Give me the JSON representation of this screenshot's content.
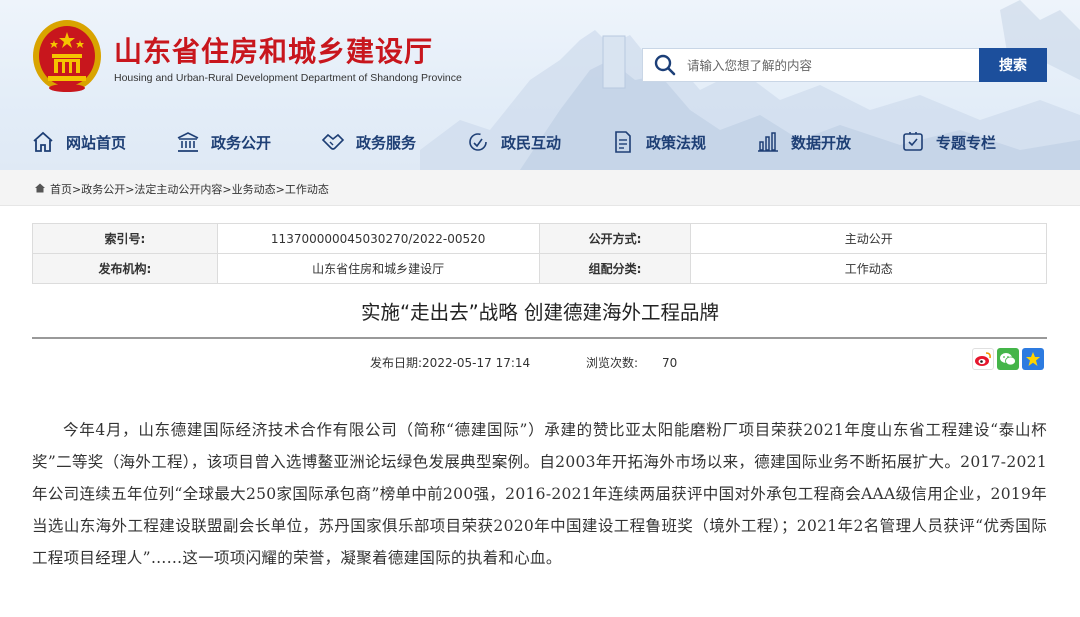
{
  "header": {
    "title": "山东省住房和城乡建设厅",
    "subtitle": "Housing and Urban-Rural Development Department of Shandong Province",
    "brand_color": "#c8161d"
  },
  "search": {
    "placeholder": "请输入您想了解的内容",
    "button_label": "搜索",
    "button_color": "#1c4f9c"
  },
  "nav": {
    "items": [
      {
        "label": "网站首页",
        "icon": "home-icon"
      },
      {
        "label": "政务公开",
        "icon": "government-building-icon"
      },
      {
        "label": "政务服务",
        "icon": "handshake-icon"
      },
      {
        "label": "政民互动",
        "icon": "interaction-icon"
      },
      {
        "label": "政策法规",
        "icon": "document-icon"
      },
      {
        "label": "数据开放",
        "icon": "bar-chart-icon"
      },
      {
        "label": "专题专栏",
        "icon": "topic-icon"
      }
    ]
  },
  "breadcrumb": {
    "text": "首页>政务公开>法定主动公开内容>业务动态>工作动态"
  },
  "meta": {
    "index_label": "索引号:",
    "index_value": "113700000045030270/2022-00520",
    "open_mode_label": "公开方式:",
    "open_mode_value": "主动公开",
    "publisher_label": "发布机构:",
    "publisher_value": "山东省住房和城乡建设厅",
    "category_label": "组配分类:",
    "category_value": "工作动态"
  },
  "article": {
    "title": "实施“走出去”战略 创建德建海外工程品牌",
    "publish_date_label": "发布日期:",
    "publish_date": "2022-05-17 17:14",
    "views_label": "浏览次数:",
    "views": "70",
    "body": "今年4月，山东德建国际经济技术合作有限公司（简称“德建国际”）承建的赞比亚太阳能磨粉厂项目荣获2021年度山东省工程建设“泰山杯奖”二等奖（海外工程），该项目曾入选博鳌亚洲论坛绿色发展典型案例。自2003年开拓海外市场以来，德建国际业务不断拓展扩大。2017-2021年公司连续五年位列“全球最大250家国际承包商”榜单中前200强，2016-2021年连续两届获评中国对外承包工程商会AAA级信用企业，2019年当选山东海外工程建设联盟副会长单位，苏丹国家俱乐部项目荣获2020年中国建设工程鲁班奖（境外工程）；2021年2名管理人员获评“优秀国际工程项目经理人”……这一项项闪耀的荣誉，凝聚着德建国际的执着和心血。"
  },
  "share": {
    "icons": [
      "weibo-icon",
      "wechat-icon",
      "favorite-star-icon"
    ]
  }
}
